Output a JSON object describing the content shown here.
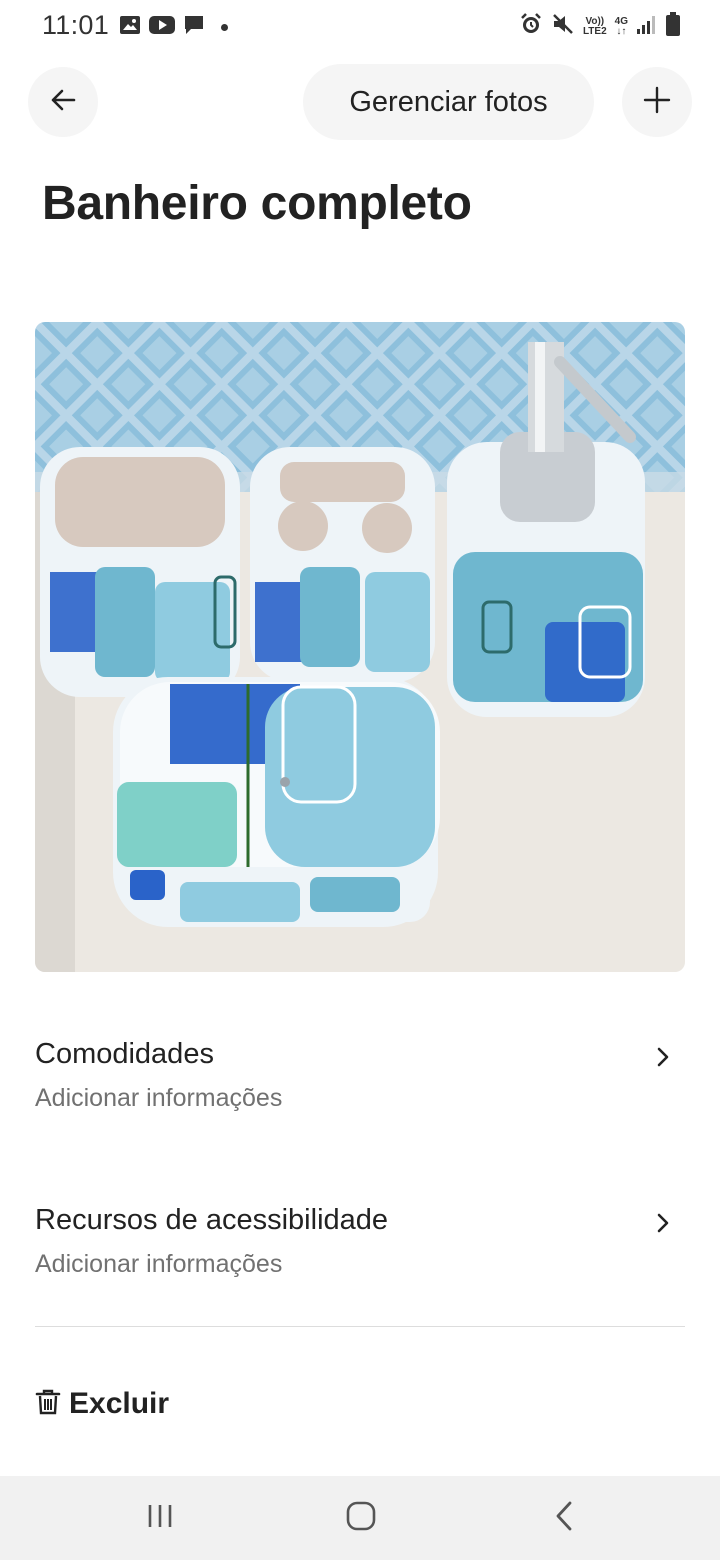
{
  "status_bar": {
    "time": "11:01",
    "left_icons": [
      "image-icon",
      "youtube-icon",
      "chat-icon",
      "dot-icon"
    ],
    "right_icons": [
      "alarm-icon",
      "mute-icon",
      "volte-icon",
      "4g-icon",
      "signal-icon",
      "battery-icon"
    ],
    "volte_label_top": "Vo))",
    "volte_label_bottom": "LTE2",
    "network_label": "4G"
  },
  "header": {
    "back_icon": "arrow-left-icon",
    "manage_photos_label": "Gerenciar fotos",
    "add_icon": "plus-icon"
  },
  "page": {
    "title": "Banheiro completo"
  },
  "photo": {
    "subject": "bathroom accessory set"
  },
  "sections": [
    {
      "title": "Comodidades",
      "subtitle": "Adicionar informações",
      "icon": "chevron-right-icon"
    },
    {
      "title": "Recursos de acessibilidade",
      "subtitle": "Adicionar informações",
      "icon": "chevron-right-icon"
    }
  ],
  "delete": {
    "label": "Excluir",
    "icon": "trash-icon"
  },
  "nav_bar": {
    "icons": [
      "recents-icon",
      "home-icon",
      "back-icon"
    ]
  },
  "colors": {
    "text_primary": "#222222",
    "text_secondary": "#717171",
    "button_bg": "#f5f5f5",
    "divider": "#dddddd",
    "nav_bg": "#f1f1f1"
  }
}
